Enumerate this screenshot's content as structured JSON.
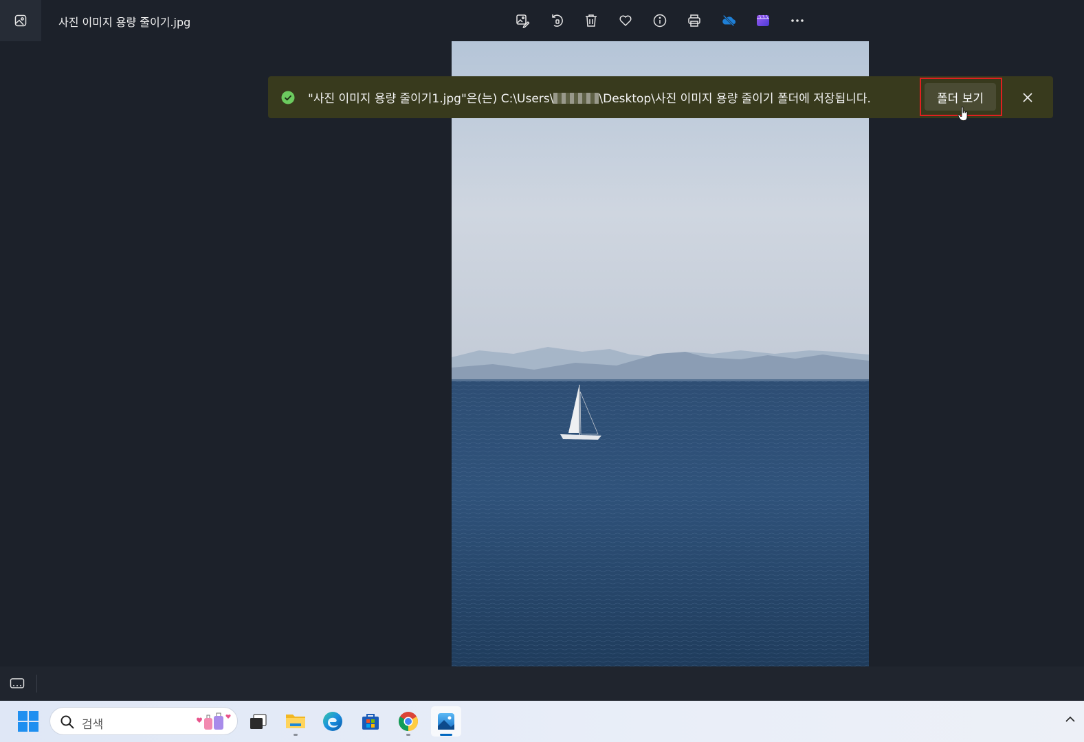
{
  "window": {
    "title": "사진 이미지 용량 줄이기.jpg",
    "app_icon": "photos-app-icon"
  },
  "toolbar": {
    "buttons": [
      {
        "name": "edit-image-button",
        "icon": "edit-image-icon"
      },
      {
        "name": "rotate-button",
        "icon": "rotate-icon"
      },
      {
        "name": "delete-button",
        "icon": "trash-icon"
      },
      {
        "name": "favorite-button",
        "icon": "heart-icon"
      },
      {
        "name": "info-button",
        "icon": "info-icon"
      },
      {
        "name": "print-button",
        "icon": "printer-icon"
      },
      {
        "name": "onedrive-button",
        "icon": "onedrive-cloud-off-icon"
      },
      {
        "name": "clipchamp-button",
        "icon": "clipchamp-icon"
      },
      {
        "name": "more-button",
        "icon": "ellipsis-icon"
      }
    ]
  },
  "toast": {
    "message_part1": "\"사진 이미지 용량 줄이기1.jpg\"은(는) C:\\Users\\",
    "message_part2": "\\Desktop\\사진 이미지 용량 줄이기 폴더에 저장됩니다.",
    "action_label": "폴더 보기",
    "status": "success",
    "colors": {
      "background": "#383a1d",
      "success": "#6ccb5f",
      "highlight": "#e02020"
    }
  },
  "taskbar": {
    "search_placeholder": "검색",
    "apps": [
      "start-icon",
      "task-view-icon",
      "file-explorer-icon",
      "edge-icon",
      "store-icon",
      "chrome-icon",
      "photos-icon"
    ]
  }
}
